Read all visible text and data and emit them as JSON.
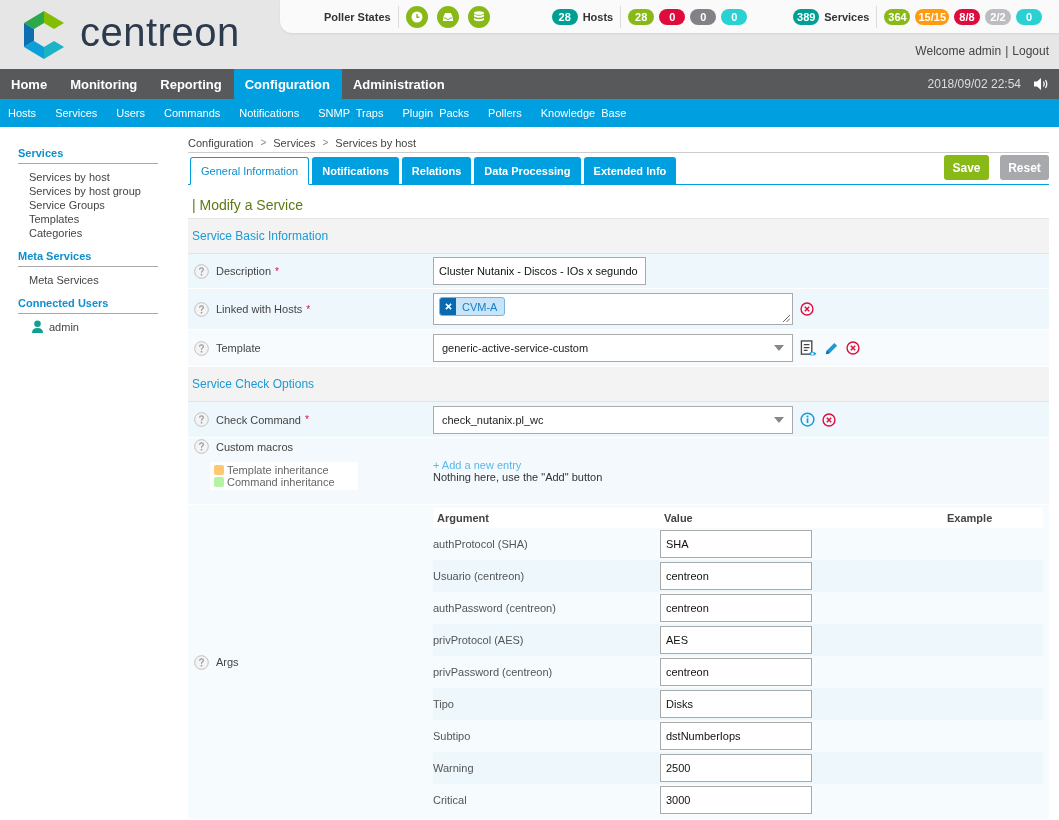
{
  "header": {
    "logo_text": "centreon",
    "poller_states": {
      "label": "Poller States"
    },
    "hosts": {
      "label": "Hosts",
      "total": {
        "text": "28",
        "color": "#009f94"
      },
      "badges": [
        {
          "text": "28",
          "color": "#88b917"
        },
        {
          "text": "0",
          "color": "#e00b3d"
        },
        {
          "text": "0",
          "color": "#818285"
        },
        {
          "text": "0",
          "color": "#29d1d3"
        }
      ]
    },
    "services": {
      "label": "Services",
      "total": {
        "text": "389",
        "color": "#009f94"
      },
      "badges": [
        {
          "text": "364",
          "color": "#88b917"
        },
        {
          "text": "15/15",
          "color": "#ff9a13"
        },
        {
          "text": "8/8",
          "color": "#e00b3d"
        },
        {
          "text": "2/2",
          "color": "#bcbdc0"
        },
        {
          "text": "0",
          "color": "#29d1d3"
        }
      ]
    },
    "welcome": {
      "greeting": "Welcome admin",
      "separator": "|",
      "logout": "Logout"
    }
  },
  "main_nav": {
    "items": [
      {
        "label": "Home",
        "selected": false
      },
      {
        "label": "Monitoring",
        "selected": false
      },
      {
        "label": "Reporting",
        "selected": false
      },
      {
        "label": "Configuration",
        "selected": true
      },
      {
        "label": "Administration",
        "selected": false
      }
    ],
    "datetime": "2018/09/02 22:54"
  },
  "sub_nav": {
    "items": [
      "Hosts",
      "Services",
      "Users",
      "Commands",
      "Notifications",
      "SNMP  Traps",
      "Plugin  Packs",
      "Pollers",
      "Knowledge  Base"
    ]
  },
  "sidebar": {
    "sections": [
      {
        "title": "Services",
        "items": [
          "Services by host",
          "Services by host group",
          "Service Groups",
          "Templates",
          "Categories"
        ]
      },
      {
        "title": "Meta Services",
        "items": [
          "Meta Services"
        ]
      },
      {
        "title": "Connected Users",
        "users": [
          "admin"
        ]
      }
    ]
  },
  "breadcrumb": [
    {
      "kind": "link",
      "text": "Configuration"
    },
    {
      "kind": "separator",
      "text": ">"
    },
    {
      "kind": "link",
      "text": "Services"
    },
    {
      "kind": "separator",
      "text": ">"
    },
    {
      "kind": "link",
      "text": "Services by host"
    }
  ],
  "tabs": [
    {
      "label": "General Information",
      "selected": true
    },
    {
      "label": "Notifications",
      "selected": false
    },
    {
      "label": "Relations",
      "selected": false
    },
    {
      "label": "Data Processing",
      "selected": false
    },
    {
      "label": "Extended Info",
      "selected": false
    }
  ],
  "buttons": [
    {
      "kind": "primary",
      "label": "Save"
    },
    {
      "kind": "secondary",
      "label": "Reset"
    }
  ],
  "page_title": "| Modify a Service",
  "sections": [
    {
      "title": "Service Basic Information",
      "rows": [
        {
          "kind": "text",
          "label": "Description",
          "required_mark": "*",
          "value": "Cluster Nutanix - Discos - IOs x segundo"
        },
        {
          "kind": "multiselect",
          "label": "Linked with Hosts",
          "required_mark": "*",
          "tags": [
            "CVM-A"
          ]
        },
        {
          "kind": "template_select",
          "label": "Template",
          "value": "generic-active-service-custom"
        }
      ]
    },
    {
      "title": "Service Check Options",
      "rows": [
        {
          "kind": "command_select",
          "label": "Check Command",
          "required_mark": "*",
          "value": "check_nutanix.pl_wc"
        },
        {
          "kind": "macros",
          "label": "Custom macros",
          "legend": [
            {
              "label": "Template inheritance",
              "color": "#ffc870"
            },
            {
              "label": "Command inheritance",
              "color": "#b6f2a4"
            }
          ],
          "add_link": "+ Add a new entry",
          "empty_note": "Nothing here, use the \"Add\" button"
        },
        {
          "kind": "args",
          "label": "Args",
          "columns": [
            "Argument",
            "Value",
            "Example"
          ],
          "rows": [
            {
              "argument": "authProtocol (SHA)",
              "value": "SHA"
            },
            {
              "argument": "Usuario (centreon)",
              "value": "centreon"
            },
            {
              "argument": "authPassword (centreon)",
              "value": "centreon"
            },
            {
              "argument": "privProtocol (AES)",
              "value": "AES"
            },
            {
              "argument": "privPassword (centreon)",
              "value": "centreon"
            },
            {
              "argument": "Tipo",
              "value": "Disks"
            },
            {
              "argument": "Subtipo",
              "value": "dstNumberIops"
            },
            {
              "argument": "Warning",
              "value": "2500"
            },
            {
              "argument": "Critical",
              "value": "3000"
            }
          ]
        }
      ]
    }
  ]
}
